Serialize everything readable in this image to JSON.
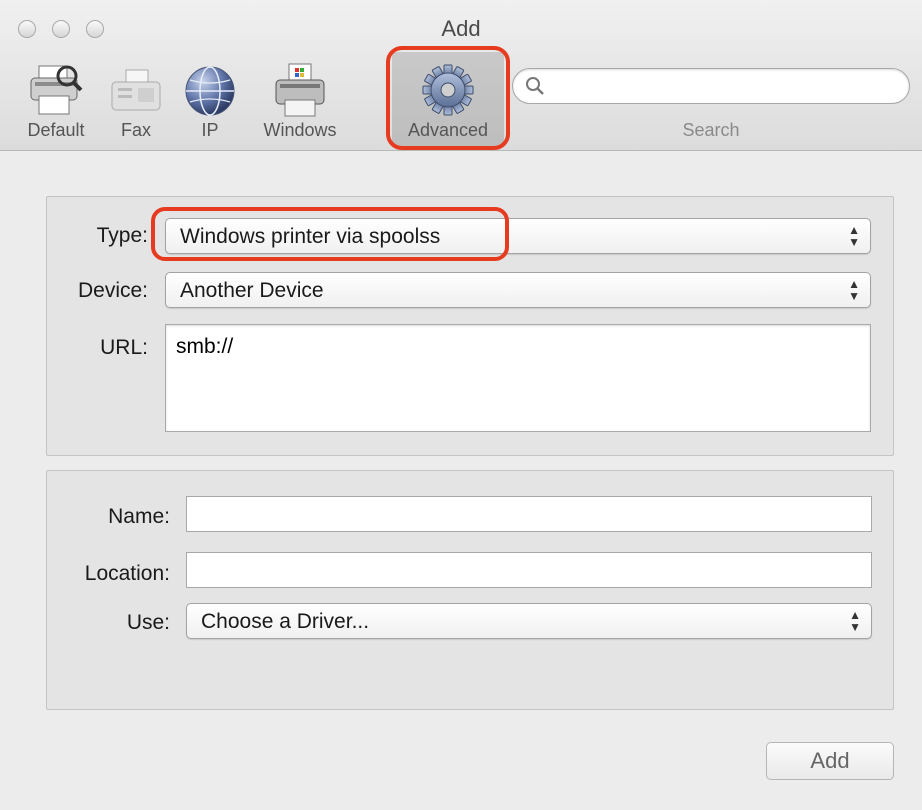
{
  "window": {
    "title": "Add"
  },
  "toolbar": {
    "default_label": "Default",
    "fax_label": "Fax",
    "ip_label": "IP",
    "windows_label": "Windows",
    "advanced_label": "Advanced",
    "search_label": "Search",
    "search_value": "",
    "search_placeholder": ""
  },
  "connection": {
    "type_label": "Type:",
    "type_value": "Windows printer via spoolss",
    "device_label": "Device:",
    "device_value": "Another Device",
    "url_label": "URL:",
    "url_value": "smb://"
  },
  "printer": {
    "name_label": "Name:",
    "name_value": "",
    "location_label": "Location:",
    "location_value": "",
    "use_label": "Use:",
    "use_value": "Choose a Driver..."
  },
  "footer": {
    "add_label": "Add"
  },
  "colors": {
    "highlight": "#e63b1f",
    "background": "#ececec",
    "panel": "#e4e4e4"
  }
}
